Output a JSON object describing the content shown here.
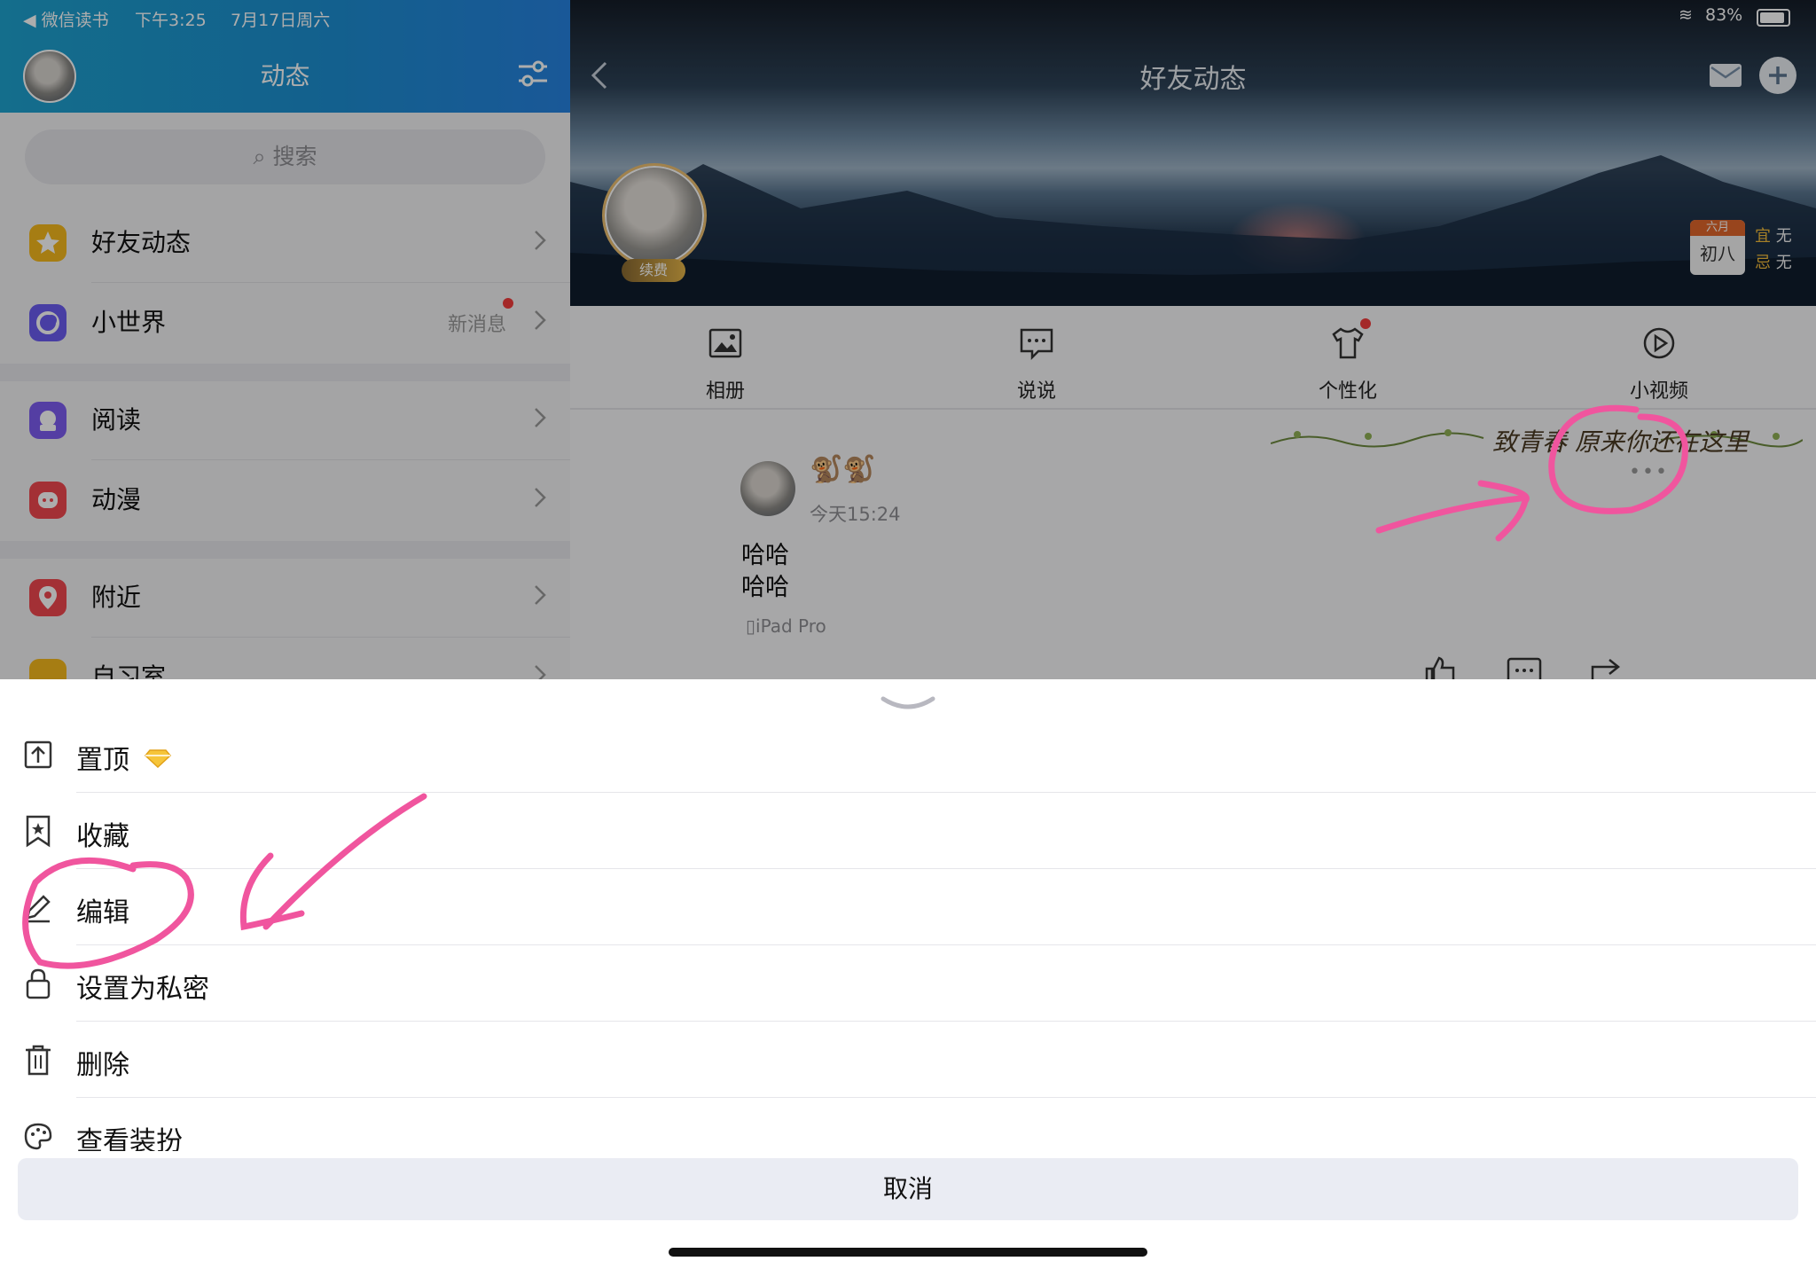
{
  "status_bar": {
    "back_app": "◀ 微信读书",
    "time": "下午3:25",
    "date": "7月17日周六",
    "battery": "83%"
  },
  "sidebar": {
    "title": "动态",
    "search_placeholder": "搜索",
    "items": [
      {
        "label": "好友动态",
        "icon": "star-icon",
        "color": "#f5b81c"
      },
      {
        "label": "小世界",
        "icon": "planet-icon",
        "color": "#6a5cf0",
        "badge": "新消息"
      },
      {
        "label": "阅读",
        "icon": "reading-icon",
        "color": "#7d5cf0"
      },
      {
        "label": "动漫",
        "icon": "anime-icon",
        "color": "#f0484e"
      },
      {
        "label": "附近",
        "icon": "location-icon",
        "color": "#f0484e"
      },
      {
        "label": "自习室",
        "icon": "study-room-icon",
        "color": "#f5b81c"
      }
    ]
  },
  "main": {
    "title": "好友动态",
    "profile": {
      "badge": "续费"
    },
    "almanac": {
      "month": "六月",
      "day": "初八",
      "good": "宜",
      "good_value": "无",
      "bad": "忌",
      "bad_value": "无"
    },
    "tabs": [
      {
        "label": "相册",
        "icon": "album-icon"
      },
      {
        "label": "说说",
        "icon": "message-icon"
      },
      {
        "label": "个性化",
        "icon": "tshirt-icon"
      },
      {
        "label": "小视频",
        "icon": "video-icon"
      }
    ],
    "decoration_text": "致青春 原来你还在这里",
    "post": {
      "emoji": "🐒🐒",
      "time": "今天15:24",
      "lines": [
        "哈哈",
        "哈哈"
      ],
      "device": "iPad Pro",
      "more": "•••"
    }
  },
  "sheet": {
    "options": [
      {
        "label": "置顶",
        "icon": "pin-top-icon"
      },
      {
        "label": "收藏",
        "icon": "bookmark-star-icon"
      },
      {
        "label": "编辑",
        "icon": "edit-icon"
      },
      {
        "label": "设置为私密",
        "icon": "lock-icon"
      },
      {
        "label": "删除",
        "icon": "trash-icon"
      },
      {
        "label": "查看装扮",
        "icon": "palette-icon"
      }
    ],
    "cancel": "取消"
  },
  "colors": {
    "header_blue": "#1c8fd0",
    "annotation_pink": "#f0559e",
    "badge_red": "#f23c3c"
  }
}
